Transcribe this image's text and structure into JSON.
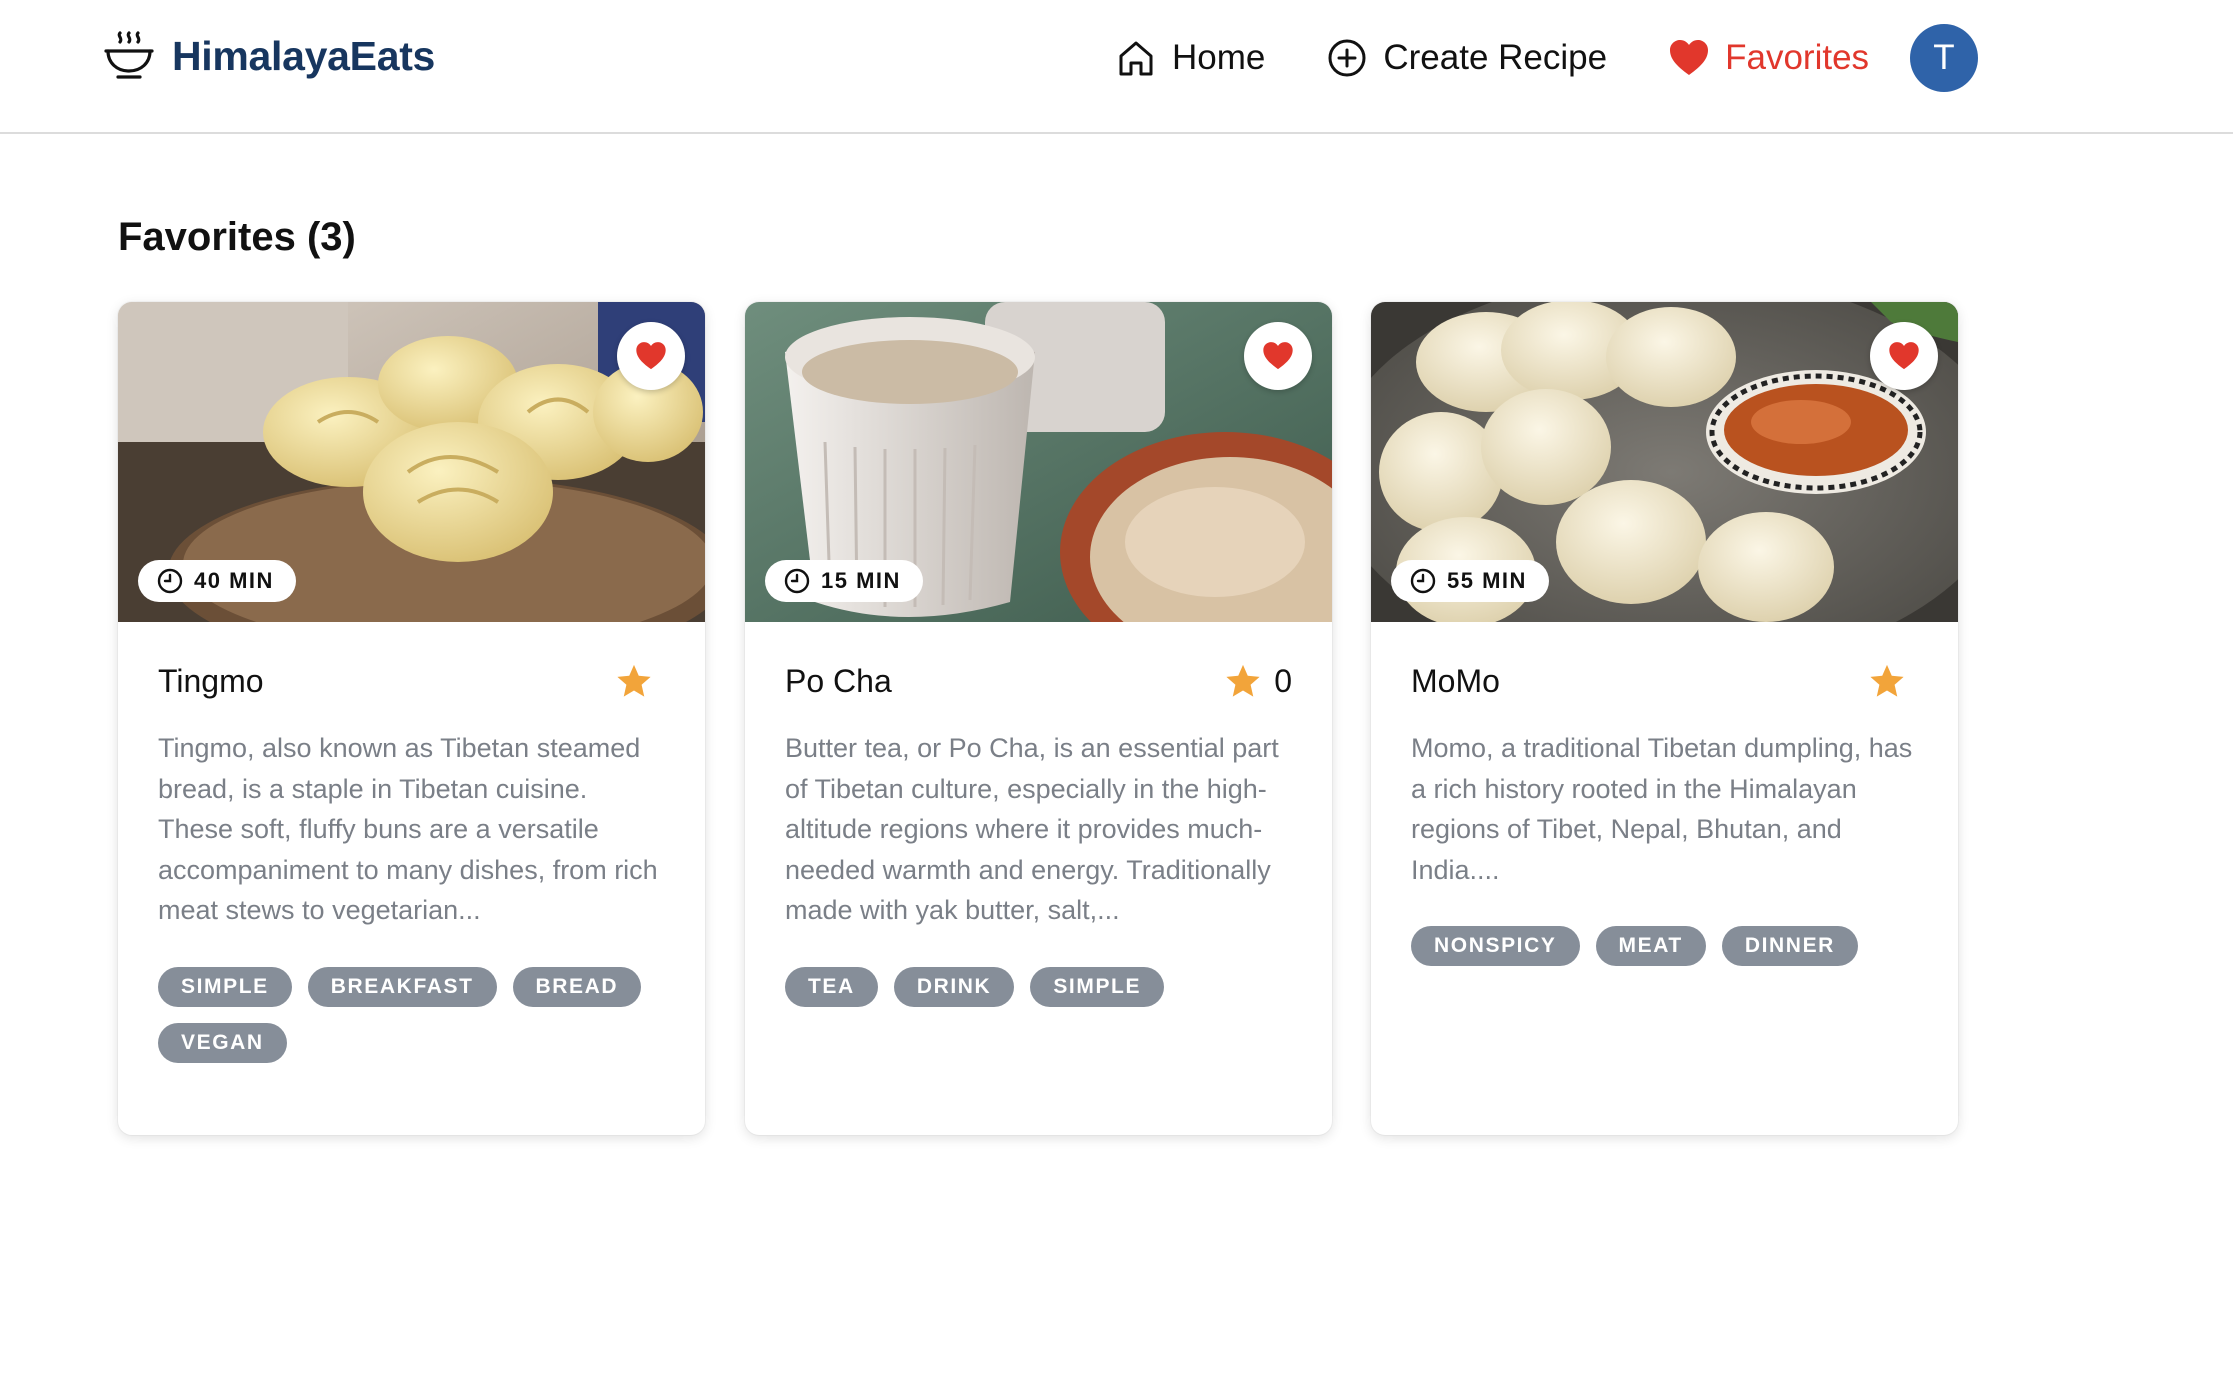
{
  "brand": {
    "name": "HimalayaEats",
    "logo_icon": "bowl-icon"
  },
  "nav": {
    "items": [
      {
        "label": "Home",
        "icon": "home-icon"
      },
      {
        "label": "Create Recipe",
        "icon": "plus-circle-icon"
      },
      {
        "label": "Favorites",
        "icon": "heart-icon",
        "active": true
      }
    ],
    "avatar_initial": "T"
  },
  "colors": {
    "brand": "#17365f",
    "accent": "#e1372c",
    "avatar": "#2f63a9",
    "tag": "#868e99",
    "star": "#f2a43a"
  },
  "page": {
    "title": "Favorites (3)"
  },
  "recipes": [
    {
      "title": "Tingmo",
      "time": "40 MIN",
      "rating": "",
      "description": "Tingmo, also known as Tibetan steamed bread, is a staple in Tibetan cuisine. These soft, fluffy buns are a versatile accompaniment to many dishes, from rich meat stews to vegetarian...",
      "tags": [
        "SIMPLE",
        "BREAKFAST",
        "BREAD",
        "VEGAN"
      ]
    },
    {
      "title": "Po Cha",
      "time": "15 MIN",
      "rating": "0",
      "description": "Butter tea, or Po Cha, is an essential part of Tibetan culture, especially in the high-altitude regions where it provides much-needed warmth and energy. Traditionally made with yak butter, salt,...",
      "tags": [
        "TEA",
        "DRINK",
        "SIMPLE"
      ]
    },
    {
      "title": "MoMo",
      "time": "55 MIN",
      "rating": "",
      "description": "Momo, a traditional Tibetan dumpling, has a rich history rooted in the Himalayan regions of Tibet, Nepal, Bhutan, and India....",
      "tags": [
        "NONSPICY",
        "MEAT",
        "DINNER"
      ]
    }
  ]
}
